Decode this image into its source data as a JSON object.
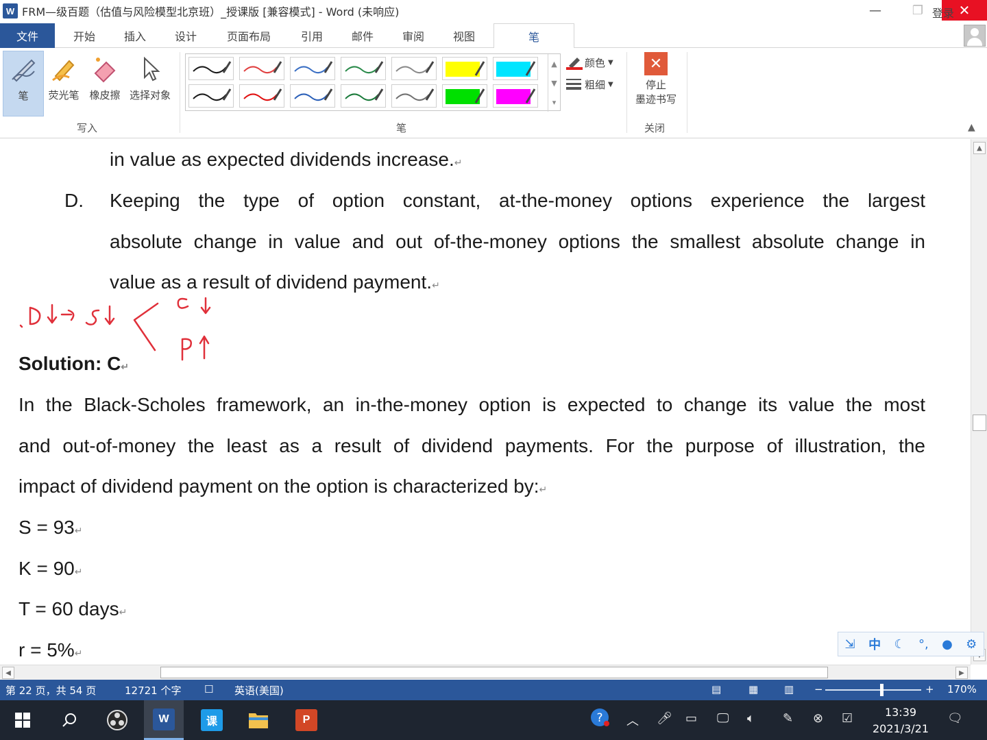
{
  "window": {
    "app_icon": "W",
    "title": "FRM—级百题（估值与风险模型北京班）_授课版 [兼容模式] - Word (未响应)",
    "minimize": "—",
    "maximize": "❐",
    "close": "✕"
  },
  "tabs": {
    "file": "文件",
    "items": [
      "开始",
      "插入",
      "设计",
      "页面布局",
      "引用",
      "邮件",
      "审阅",
      "视图"
    ],
    "active": "笔",
    "login": "登录"
  },
  "ribbon": {
    "write_group": {
      "label": "写入",
      "buttons": [
        "笔",
        "荧光笔",
        "橡皮擦",
        "选择对象"
      ]
    },
    "pen_group": {
      "label": "笔",
      "pens_row1": [
        "#1a1a1a",
        "#e04040",
        "#3a6fc4",
        "#2a8a4a",
        "#8a8a8a",
        "#ffff00",
        "#00e5ff"
      ],
      "pens_row2": [
        "#1a1a1a",
        "#e01010",
        "#2a5fb8",
        "#1a7a3a",
        "#707070",
        "#00e000",
        "#ff00ff"
      ],
      "color_label": "颜色",
      "weight_label": "粗细"
    },
    "close_group": {
      "label": "关闭",
      "stop_line1": "停止",
      "stop_line2": "墨迹书写"
    }
  },
  "document": {
    "line1": "in value as expected dividends increase.",
    "option_d_letter": "D.",
    "option_d_line1": "Keeping the type of option constant, at-the-money options experience the largest",
    "option_d_line2": "absolute change in value and out of-the-money options the smallest absolute change in",
    "option_d_line3": "value as a result of dividend payment.",
    "solution": "Solution: C",
    "explanation_line1": "In the Black-Scholes framework, an in-the-money option is expected to change its value the most",
    "explanation_line2": "and out-of-money the least as a result of dividend payments. For the purpose of illustration, the",
    "explanation_line3": "impact of dividend payment on the option is characterized by:",
    "s_value": "S = 93",
    "k_value": "K = 90",
    "t_value": "T = 60 days",
    "r_value": "r = 5%",
    "para_mark": "↵"
  },
  "ime_bar": [
    "中"
  ],
  "status_bar": {
    "page": "第 22 页，共 54 页",
    "words": "12721 个字",
    "language": "英语(美国)",
    "zoom": "170%",
    "zoom_percent": 170
  },
  "taskbar": {
    "time": "13:39",
    "date": "2021/3/21"
  },
  "colors": {
    "accent": "#2b579a",
    "ink": "#e0303a",
    "close": "#e81123"
  }
}
